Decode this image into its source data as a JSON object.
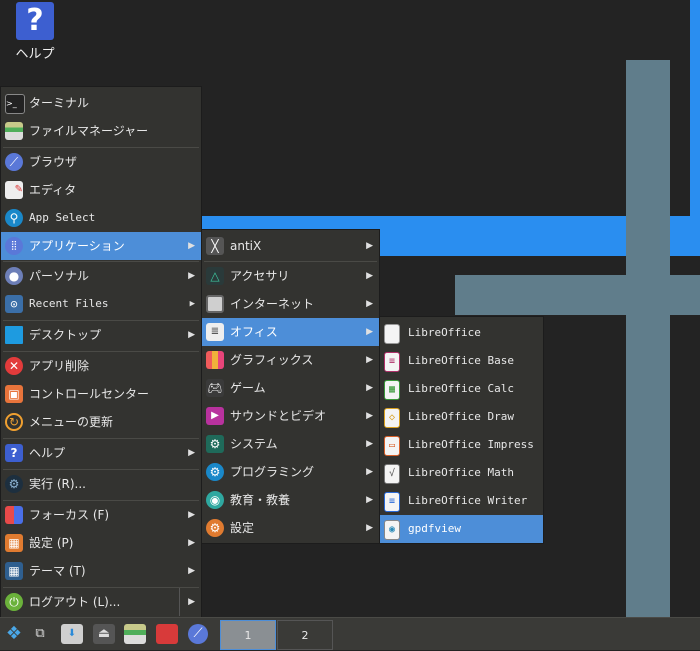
{
  "colors": {
    "accent": "#4d8ed8",
    "menu_bg": "#333330",
    "wall_blue": "#2a8ef0",
    "wall_slate": "#607d8b"
  },
  "desktop": {
    "help_icon_glyph": "?",
    "help_label": "ヘルプ"
  },
  "main_menu": {
    "items": [
      {
        "label": "ターミナル",
        "icon": "terminal-icon"
      },
      {
        "label": "ファイルマネージャー",
        "icon": "file-manager-icon"
      },
      {
        "label": "ブラウザ",
        "icon": "browser-icon"
      },
      {
        "label": "エディタ",
        "icon": "editor-icon"
      },
      {
        "label": "App Select",
        "icon": "app-select-icon"
      },
      {
        "label": "アプリケーション",
        "icon": "applications-icon"
      },
      {
        "label": "パーソナル",
        "icon": "personal-icon"
      },
      {
        "label": "Recent Files",
        "icon": "recent-files-icon"
      },
      {
        "label": "デスクトップ",
        "icon": "desktop-icon"
      },
      {
        "label": "アプリ削除",
        "icon": "remove-app-icon"
      },
      {
        "label": "コントロールセンター",
        "icon": "control-center-icon"
      },
      {
        "label": "メニューの更新",
        "icon": "refresh-menu-icon"
      },
      {
        "label": "ヘルプ",
        "icon": "help-icon"
      },
      {
        "label": "実行 (R)...",
        "icon": "run-icon"
      },
      {
        "label": "フォーカス (F)",
        "icon": "focus-icon"
      },
      {
        "label": "設定 (P)",
        "icon": "settings-icon"
      },
      {
        "label": "テーマ (T)",
        "icon": "theme-icon"
      },
      {
        "label": "ログアウト (L)...",
        "icon": "logout-icon"
      }
    ]
  },
  "apps_menu": {
    "items": [
      {
        "label": "antiX",
        "icon": "antix-icon"
      },
      {
        "label": "アクセサリ",
        "icon": "accessories-icon"
      },
      {
        "label": "インターネット",
        "icon": "internet-icon"
      },
      {
        "label": "オフィス",
        "icon": "office-icon"
      },
      {
        "label": "グラフィックス",
        "icon": "graphics-icon"
      },
      {
        "label": "ゲーム",
        "icon": "games-icon"
      },
      {
        "label": "サウンドとビデオ",
        "icon": "sound-video-icon"
      },
      {
        "label": "システム",
        "icon": "system-icon"
      },
      {
        "label": "プログラミング",
        "icon": "programming-icon"
      },
      {
        "label": "教育・教養",
        "icon": "education-icon"
      },
      {
        "label": "設定",
        "icon": "settings-icon"
      }
    ]
  },
  "office_menu": {
    "items": [
      {
        "label": "LibreOffice",
        "icon": "libreoffice-icon"
      },
      {
        "label": "LibreOffice Base",
        "icon": "libreoffice-base-icon"
      },
      {
        "label": "LibreOffice Calc",
        "icon": "libreoffice-calc-icon"
      },
      {
        "label": "LibreOffice Draw",
        "icon": "libreoffice-draw-icon"
      },
      {
        "label": "LibreOffice Impress",
        "icon": "libreoffice-impress-icon"
      },
      {
        "label": "LibreOffice Math",
        "icon": "libreoffice-math-icon"
      },
      {
        "label": "LibreOffice Writer",
        "icon": "libreoffice-writer-icon"
      },
      {
        "label": "gpdfview",
        "icon": "gpdfview-icon"
      }
    ]
  },
  "taskbar": {
    "workspaces": [
      {
        "label": "1"
      },
      {
        "label": "2"
      }
    ]
  }
}
